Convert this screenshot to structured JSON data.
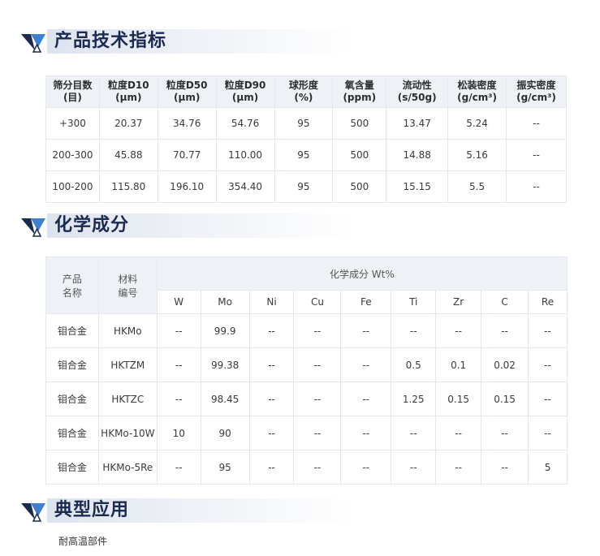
{
  "sections": {
    "spec": {
      "title": "产品技术指标"
    },
    "composition": {
      "title": "化学成分"
    },
    "application": {
      "title": "典型应用",
      "text": "耐高温部件"
    }
  },
  "spec_table": {
    "headers": [
      {
        "line1": "筛分目数",
        "line2": "(目)"
      },
      {
        "line1": "粒度D10",
        "line2": "(μm)"
      },
      {
        "line1": "粒度D50",
        "line2": "(μm)"
      },
      {
        "line1": "粒度D90",
        "line2": "(μm)"
      },
      {
        "line1": "球形度",
        "line2": "(%)"
      },
      {
        "line1": "氧含量",
        "line2": "(ppm)"
      },
      {
        "line1": "流动性",
        "line2": "(s/50g)"
      },
      {
        "line1": "松装密度",
        "line2": "(g/cm³)"
      },
      {
        "line1": "振实密度",
        "line2": "(g/cm³)"
      }
    ],
    "rows": [
      [
        "+300",
        "20.37",
        "34.76",
        "54.76",
        "95",
        "500",
        "13.47",
        "5.24",
        "--"
      ],
      [
        "200-300",
        "45.88",
        "70.77",
        "110.00",
        "95",
        "500",
        "14.88",
        "5.16",
        "--"
      ],
      [
        "100-200",
        "115.80",
        "196.10",
        "354.40",
        "95",
        "500",
        "15.15",
        "5.5",
        "--"
      ]
    ]
  },
  "composition_table": {
    "col1_line1": "产品",
    "col1_line2": "名称",
    "col2_line1": "材料",
    "col2_line2": "编号",
    "group_header": "化学成分 Wt%",
    "elements": [
      "W",
      "Mo",
      "Ni",
      "Cu",
      "Fe",
      "Ti",
      "Zr",
      "C",
      "Re"
    ],
    "rows": [
      [
        "钼合金",
        "HKMo",
        "--",
        "99.9",
        "--",
        "--",
        "--",
        "--",
        "--",
        "--",
        "--"
      ],
      [
        "钼合金",
        "HKTZM",
        "--",
        "99.38",
        "--",
        "--",
        "--",
        "0.5",
        "0.1",
        "0.02",
        "--"
      ],
      [
        "钼合金",
        "HKTZC",
        "--",
        "98.45",
        "--",
        "--",
        "--",
        "1.25",
        "0.15",
        "0.15",
        "--"
      ],
      [
        "钼合金",
        "HKMo-10W",
        "10",
        "90",
        "--",
        "--",
        "--",
        "--",
        "--",
        "--",
        "--"
      ],
      [
        "钼合金",
        "HKMo-5Re",
        "--",
        "95",
        "--",
        "--",
        "--",
        "--",
        "--",
        "--",
        "5"
      ]
    ]
  },
  "colors": {
    "brand_navy": "#1b2a4f",
    "brand_blue": "#3e7fd0",
    "header_bg": "#eef1f6"
  }
}
